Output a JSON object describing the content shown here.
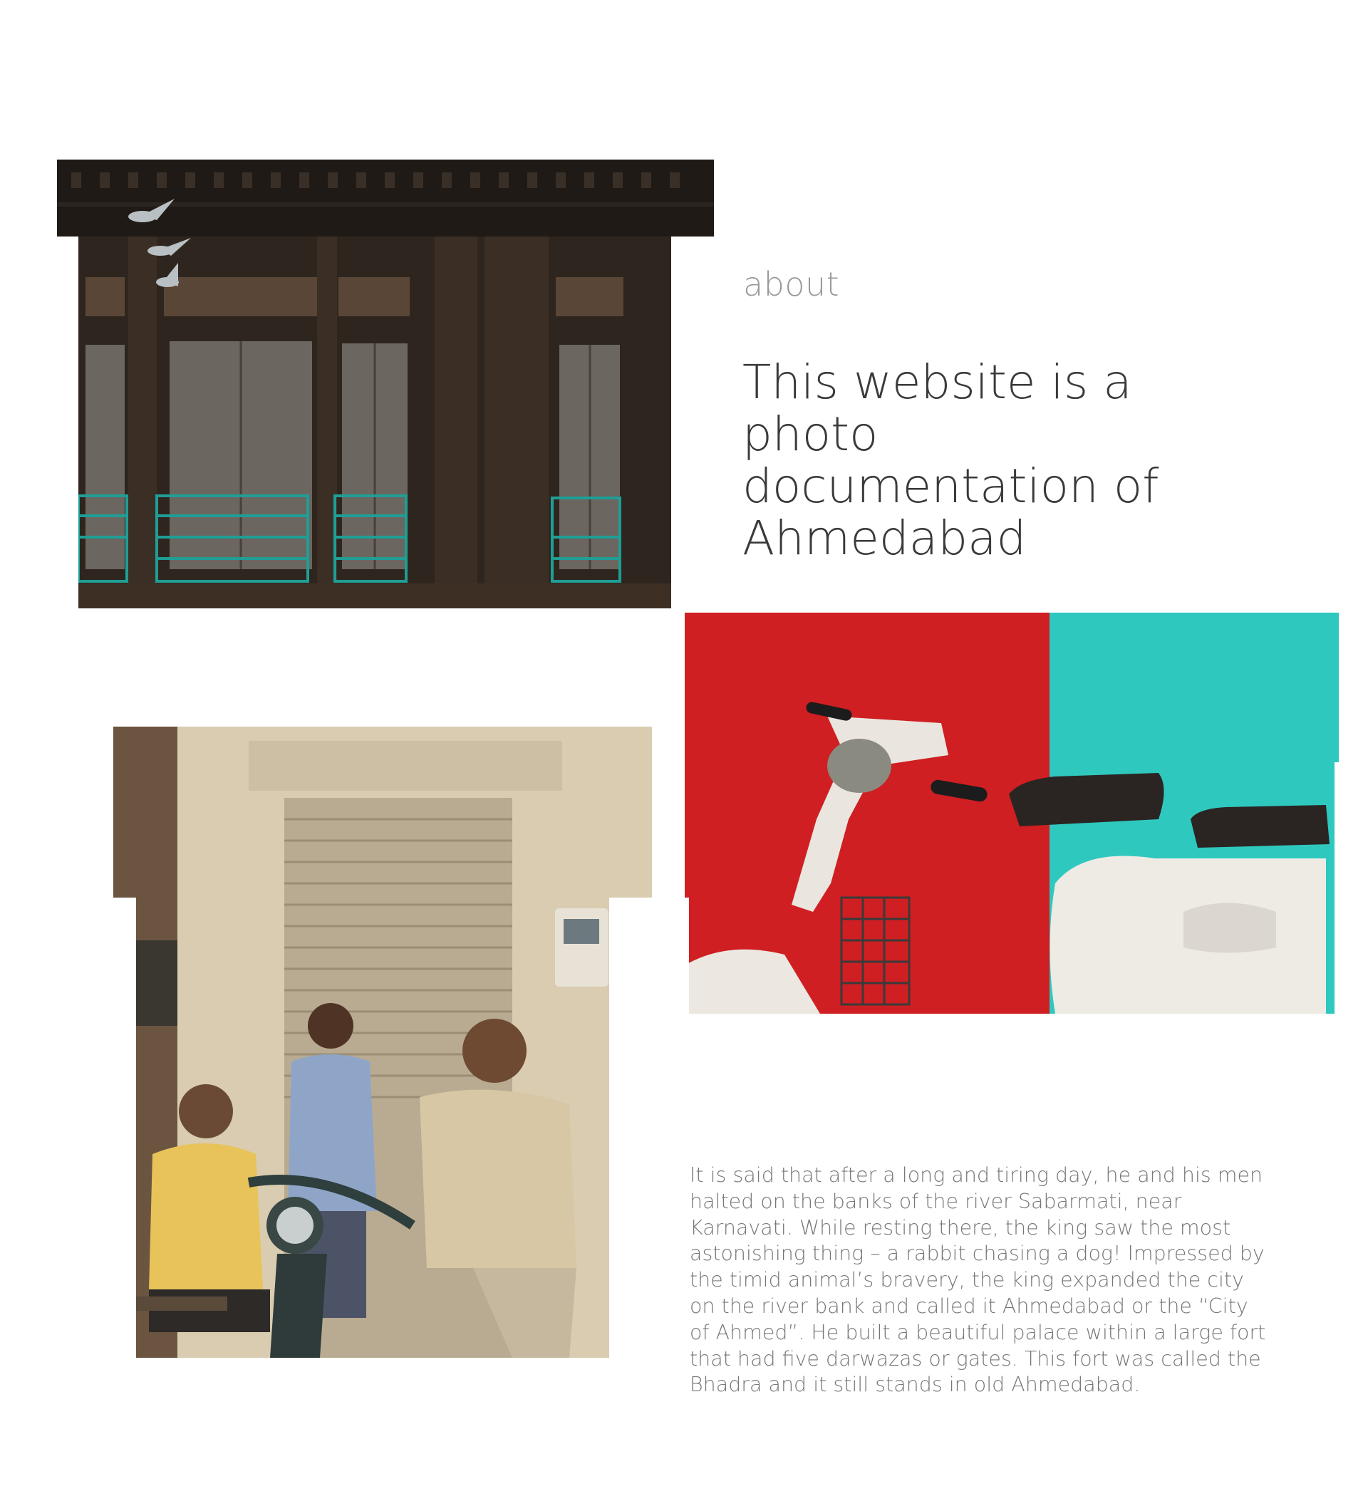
{
  "about": {
    "label": "about",
    "headline": "This website is a photo documentation of Ahmedabad",
    "story": "It is said that after a long and tiring day, he and his men halted on the banks of the river Sabarmati, near Karnavati. While resting there, the king saw the most astonishing thing – a rabbit chasing a dog! Impressed by the timid animal’s bravery, the king expanded the city on the river bank and called it Ahmedabad or the “City of Ahmed”. He built a beautiful palace within a large fort that had five darwazas or gates. This fort was called the Bhadra and it still stands in old Ahmedabad."
  },
  "photos": [
    {
      "id": "facade",
      "icon": "carved-wooden-facade-photo"
    },
    {
      "id": "scooter",
      "icon": "scooter-red-teal-wall-photo"
    },
    {
      "id": "men",
      "icon": "men-by-shutter-photo"
    }
  ],
  "colors": {
    "background": "#ffffff",
    "label": "#9a9a9a",
    "headline": "#3a3a3a",
    "body_text": "#777777"
  }
}
